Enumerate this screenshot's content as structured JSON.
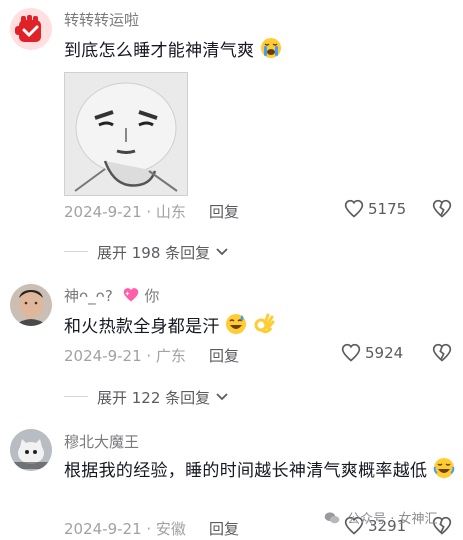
{
  "comments": [
    {
      "username": "转转转运啦",
      "text": "到底怎么睡才能神清气爽",
      "emoji": "loudly-crying-face-emoji",
      "date_location": "2024-9-21 · 山东",
      "reply_label": "回复",
      "likes": "5175",
      "expand_replies": "展开 198 条回复"
    },
    {
      "username": "神ᴖ_ᴖ?",
      "username_suffix": "你",
      "text": "和火热款全身都是汗",
      "emoji": "grinning-sweat-face-emoji",
      "date_location": "2024-9-21 · 广东",
      "reply_label": "回复",
      "likes": "5924",
      "expand_replies": "展开 122 条回复"
    },
    {
      "username": "穆北大魔王",
      "text": "根据我的经验，睡的时间越长神清气爽概率越低",
      "emoji": "rolling-laughing-face-emoji",
      "date_location": "2024-9-21 · 安徽",
      "reply_label": "回复",
      "likes": "3291"
    }
  ],
  "watermark": "公众号 · 女神汇",
  "colors": {
    "heart_accent": "#fe2c55",
    "muted": "#a1a1a6"
  }
}
